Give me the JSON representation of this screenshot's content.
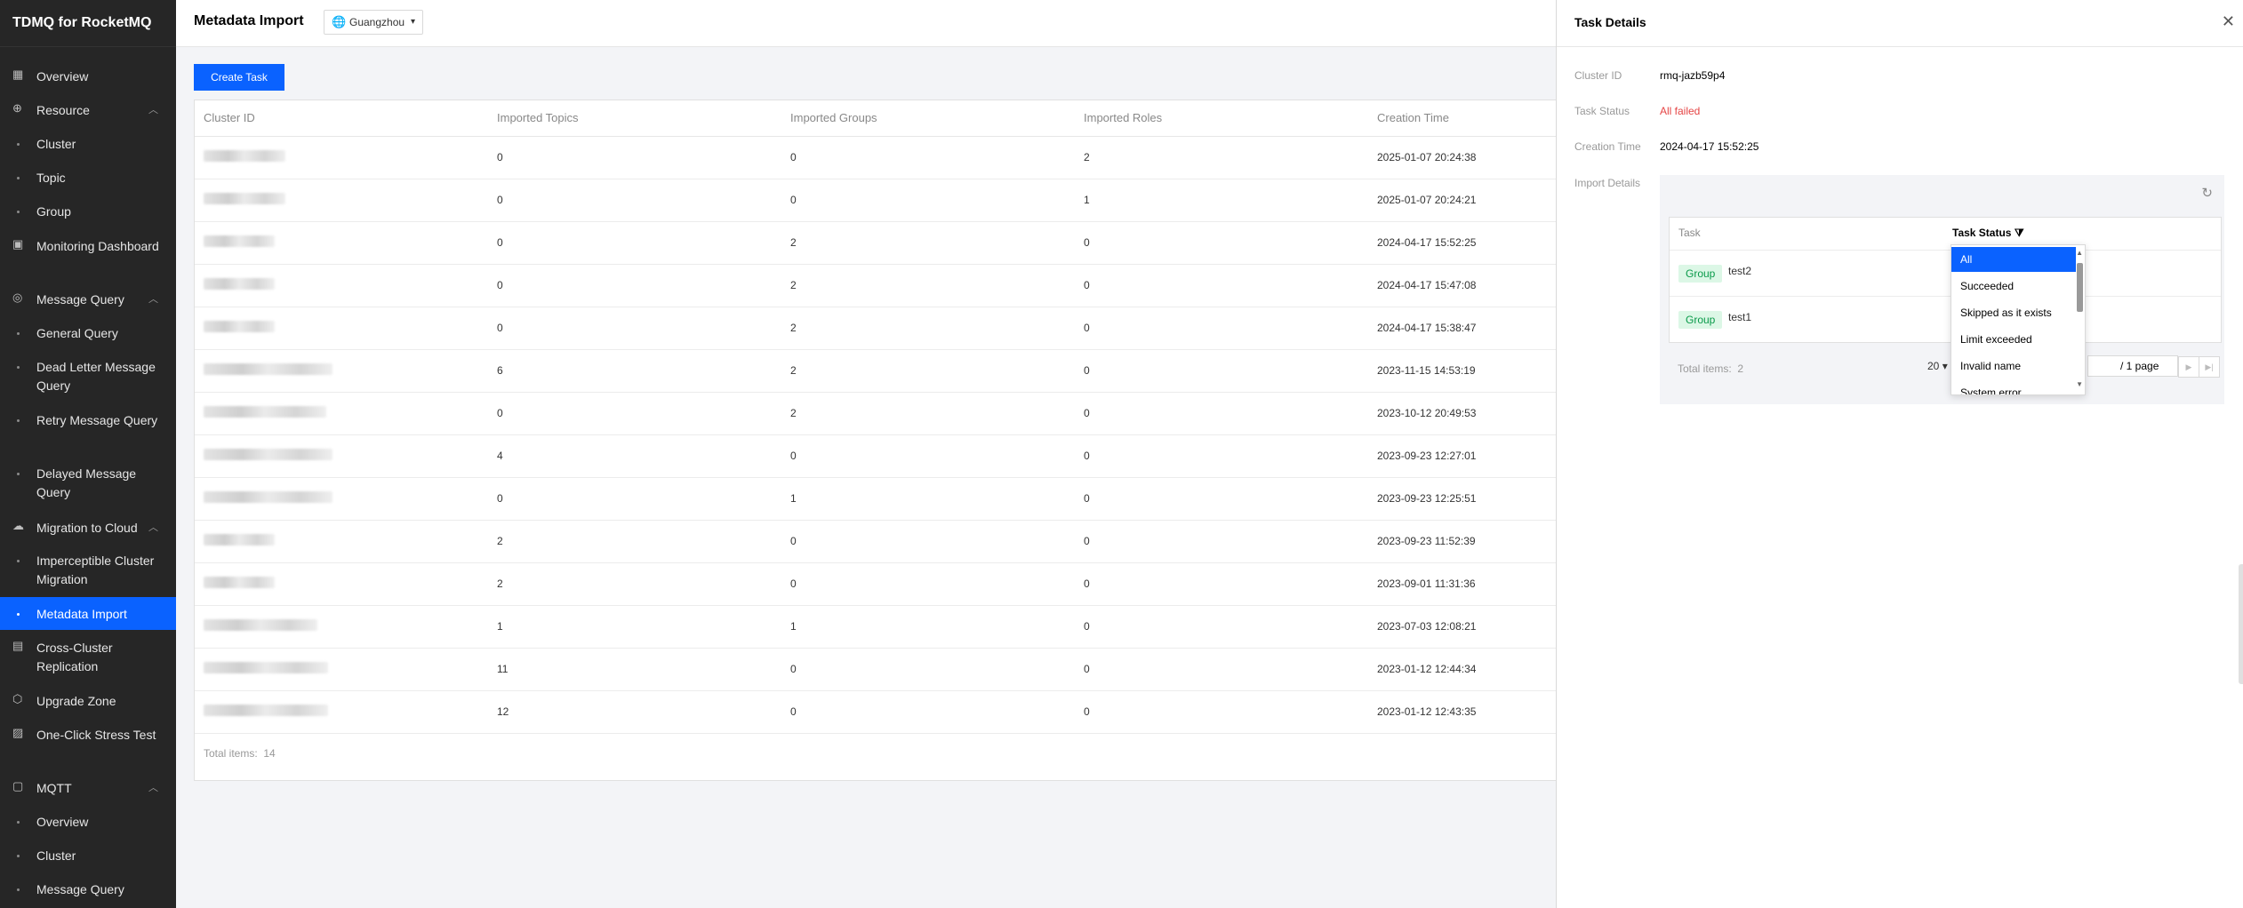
{
  "sidebar": {
    "brand": "TDMQ for RocketMQ",
    "items": [
      {
        "label": "Overview",
        "icon": "grid-icon"
      },
      {
        "label": "Resource",
        "icon": "globe-icon"
      },
      {
        "label": "Cluster"
      },
      {
        "label": "Topic"
      },
      {
        "label": "Group"
      },
      {
        "label": "Monitoring Dashboard",
        "icon": "monitor-icon"
      },
      {
        "label": "Message Query",
        "icon": "search-icon"
      },
      {
        "label": "General Query"
      },
      {
        "label": "Dead Letter Message Query"
      },
      {
        "label": "Retry Message Query"
      },
      {
        "label": "Delayed Message Query"
      },
      {
        "label": "Migration to Cloud",
        "icon": "cloud-icon"
      },
      {
        "label": "Imperceptible Cluster Migration"
      },
      {
        "label": "Metadata Import"
      },
      {
        "label": "Cross-Cluster Replication",
        "icon": "copy-icon"
      },
      {
        "label": "Upgrade Zone",
        "icon": "upgrade-icon"
      },
      {
        "label": "One-Click Stress Test",
        "icon": "test-icon"
      },
      {
        "label": "MQTT",
        "icon": "mqtt-icon"
      },
      {
        "label": "Overview"
      },
      {
        "label": "Cluster"
      },
      {
        "label": "Message Query"
      }
    ],
    "active_color": "#0A62FF"
  },
  "header": {
    "title": "Metadata Import",
    "region": "Guangzhou"
  },
  "toolbar": {
    "create_label": "Create Task"
  },
  "table": {
    "columns": [
      "Cluster ID",
      "Imported Topics",
      "Imported Groups",
      "Imported Roles",
      "Creation Time"
    ],
    "rows": [
      {
        "topics": "0",
        "groups": "0",
        "roles": "2",
        "time": "2025-01-07 20:24:38"
      },
      {
        "topics": "0",
        "groups": "0",
        "roles": "1",
        "time": "2025-01-07 20:24:21"
      },
      {
        "topics": "0",
        "groups": "2",
        "roles": "0",
        "time": "2024-04-17 15:52:25"
      },
      {
        "topics": "0",
        "groups": "2",
        "roles": "0",
        "time": "2024-04-17 15:47:08"
      },
      {
        "topics": "0",
        "groups": "2",
        "roles": "0",
        "time": "2024-04-17 15:38:47"
      },
      {
        "topics": "6",
        "groups": "2",
        "roles": "0",
        "time": "2023-11-15 14:53:19"
      },
      {
        "topics": "0",
        "groups": "2",
        "roles": "0",
        "time": "2023-10-12 20:49:53"
      },
      {
        "topics": "4",
        "groups": "0",
        "roles": "0",
        "time": "2023-09-23 12:27:01"
      },
      {
        "topics": "0",
        "groups": "1",
        "roles": "0",
        "time": "2023-09-23 12:25:51"
      },
      {
        "topics": "2",
        "groups": "0",
        "roles": "0",
        "time": "2023-09-23 11:52:39"
      },
      {
        "topics": "2",
        "groups": "0",
        "roles": "0",
        "time": "2023-09-01 11:31:36"
      },
      {
        "topics": "1",
        "groups": "1",
        "roles": "0",
        "time": "2023-07-03 12:08:21"
      },
      {
        "topics": "11",
        "groups": "0",
        "roles": "0",
        "time": "2023-01-12 12:44:34"
      },
      {
        "topics": "12",
        "groups": "0",
        "roles": "0",
        "time": "2023-01-12 12:43:35"
      }
    ],
    "total_label": "Total items:",
    "total_value": "14"
  },
  "drawer": {
    "title": "Task Details",
    "cluster_id_label": "Cluster ID",
    "cluster_id": "rmq-jazb59p4",
    "task_status_label": "Task Status",
    "task_status": "All failed",
    "creation_time_label": "Creation Time",
    "creation_time": "2024-04-17 15:52:25",
    "import_details_label": "Import Details",
    "inner_columns": [
      "Task",
      "Task Status"
    ],
    "inner_rows": [
      {
        "tag": "Group",
        "name": "test2"
      },
      {
        "tag": "Group",
        "name": "test1"
      }
    ],
    "total_label": "Total items:",
    "total_value": "2",
    "page_size": "20",
    "page_suffix": "/ 1 page",
    "status_options": [
      "All",
      "Succeeded",
      "Skipped as it exists",
      "Limit exceeded",
      "Invalid name",
      "System error"
    ],
    "status_selected": "All",
    "failed_color": "#E54545",
    "tag_color": "#0A9A4A"
  }
}
